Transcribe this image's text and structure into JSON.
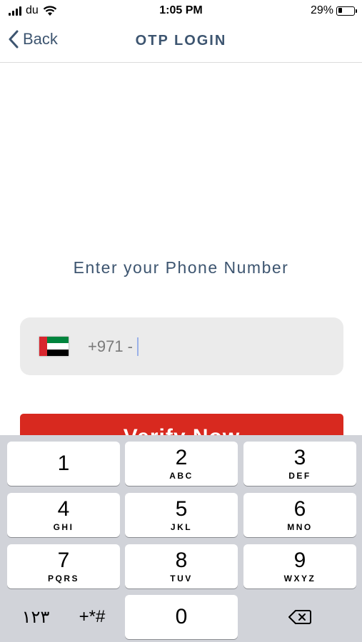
{
  "status_bar": {
    "carrier": "du",
    "time": "1:05 PM",
    "battery_percent": "29%",
    "battery_level": 0.29
  },
  "nav": {
    "back_label": "Back",
    "title": "OTP LOGIN"
  },
  "content": {
    "prompt": "Enter your Phone Number",
    "phone_prefix": "+971 -",
    "flag_colors": {
      "red": "#d8262e",
      "green": "#00843d",
      "white": "#ffffff",
      "black": "#000000"
    },
    "verify_label": "Verify Now"
  },
  "keyboard": {
    "keys": [
      {
        "num": "1",
        "letters": ""
      },
      {
        "num": "2",
        "letters": "ABC"
      },
      {
        "num": "3",
        "letters": "DEF"
      },
      {
        "num": "4",
        "letters": "GHI"
      },
      {
        "num": "5",
        "letters": "JKL"
      },
      {
        "num": "6",
        "letters": "MNO"
      },
      {
        "num": "7",
        "letters": "PQRS"
      },
      {
        "num": "8",
        "letters": "TUV"
      },
      {
        "num": "9",
        "letters": "WXYZ"
      },
      {
        "num": "0",
        "letters": ""
      }
    ],
    "arabic_numerals": "١٢٣",
    "symbols": "+*#"
  },
  "colors": {
    "accent": "#3d5570",
    "verify_button": "#d8291f",
    "field_bg": "#ebebeb",
    "keyboard_bg": "#d1d3d9"
  }
}
